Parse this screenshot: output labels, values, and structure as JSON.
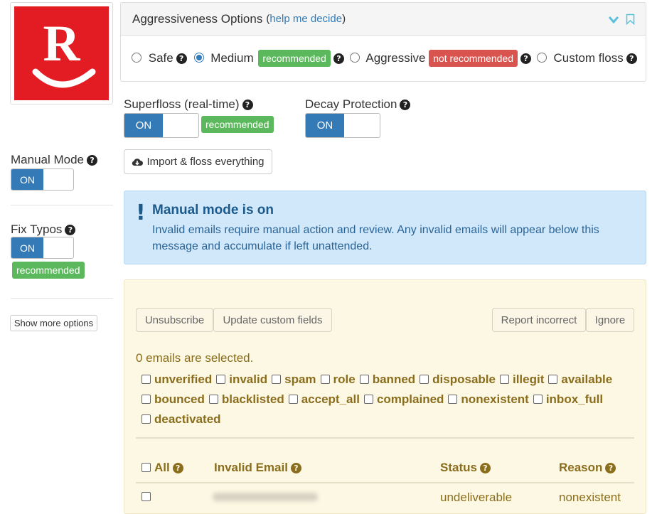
{
  "logo": {
    "letter": "R",
    "color": "#e31b23"
  },
  "aggressiveness": {
    "title": "Aggressiveness Options",
    "help_open": "(",
    "help_link": "help me decide",
    "help_close": ")",
    "options": [
      {
        "label": "Safe",
        "checked": false
      },
      {
        "label": "Medium",
        "checked": true,
        "badge": "recommended"
      },
      {
        "label": "Aggressive",
        "checked": false,
        "badge": "not recommended"
      },
      {
        "label": "Custom floss",
        "checked": false
      }
    ]
  },
  "superfloss": {
    "label": "Superfloss (real-time)",
    "state": "ON",
    "badge": "recommended"
  },
  "decay": {
    "label": "Decay Protection",
    "state": "ON"
  },
  "manual_mode": {
    "label": "Manual Mode",
    "state": "ON"
  },
  "import_button": "Import & floss everything",
  "fix_typos": {
    "label": "Fix Typos",
    "state": "ON",
    "badge": "recommended"
  },
  "show_more": "Show more options",
  "alert": {
    "mark": "!",
    "title": "Manual mode is on",
    "body": "Invalid emails require manual action and review. Any invalid emails will appear below this message and accumulate if left unattended."
  },
  "actions": {
    "unsubscribe": "Unsubscribe",
    "update_fields": "Update custom fields",
    "report": "Report incorrect",
    "ignore": "Ignore"
  },
  "selected_text": "0 emails are selected.",
  "filters": [
    [
      "unverified",
      "invalid",
      "spam",
      "role",
      "banned",
      "disposable",
      "illegit",
      "available"
    ],
    [
      "bounced",
      "blacklisted",
      "accept_all",
      "complained",
      "nonexistent",
      "inbox_full"
    ],
    [
      "deactivated"
    ]
  ],
  "table": {
    "col_all": "All",
    "col_email": "Invalid Email",
    "col_status": "Status",
    "col_reason": "Reason",
    "rows": [
      {
        "status": "undeliverable",
        "reason": "nonexistent"
      }
    ]
  },
  "colors": {
    "primary": "#337ab7",
    "success": "#5cb85c",
    "danger": "#d9534f",
    "alert_bg": "#d1e8fb",
    "warning_bg": "#fcf8e3",
    "warning_text": "#8a6d1d"
  }
}
